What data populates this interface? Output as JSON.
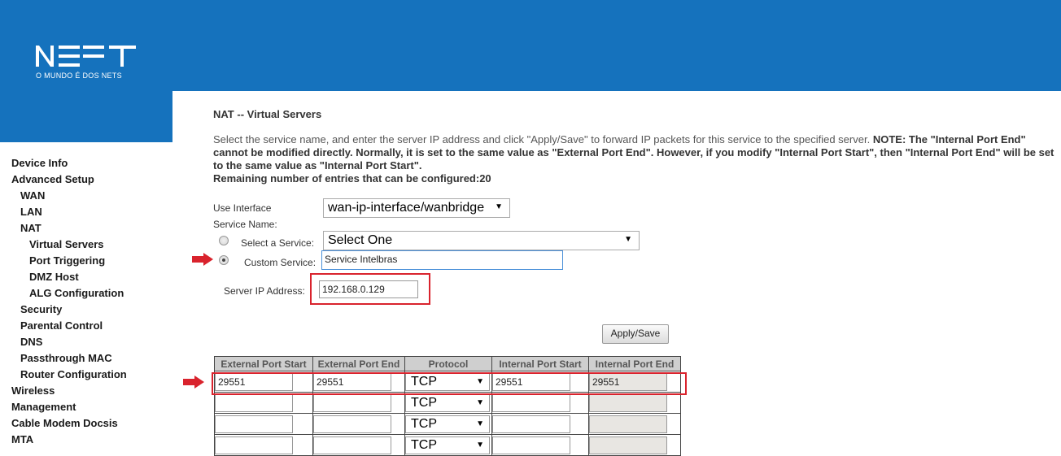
{
  "brand": {
    "logo_text": "NET",
    "tagline": "O MUNDO É DOS NETS",
    "color": "#1572bd"
  },
  "sidebar": {
    "items": [
      {
        "label": "Device Info",
        "level": 0
      },
      {
        "label": "Advanced Setup",
        "level": 0
      },
      {
        "label": "WAN",
        "level": 1
      },
      {
        "label": "LAN",
        "level": 1
      },
      {
        "label": "NAT",
        "level": 1
      },
      {
        "label": "Virtual Servers",
        "level": 2
      },
      {
        "label": "Port Triggering",
        "level": 2
      },
      {
        "label": "DMZ Host",
        "level": 2
      },
      {
        "label": "ALG Configuration",
        "level": 2
      },
      {
        "label": "Security",
        "level": 1
      },
      {
        "label": "Parental Control",
        "level": 1
      },
      {
        "label": "DNS",
        "level": 1
      },
      {
        "label": "Passthrough MAC",
        "level": 1
      },
      {
        "label": "Router Configuration",
        "level": 1
      },
      {
        "label": "Wireless",
        "level": 0
      },
      {
        "label": "Management",
        "level": 0
      },
      {
        "label": "Cable Modem Docsis",
        "level": 0
      },
      {
        "label": "MTA",
        "level": 0
      }
    ]
  },
  "page": {
    "title": "NAT -- Virtual Servers",
    "description_plain": "Select the service name, and enter the server IP address and click \"Apply/Save\" to forward IP packets for this service to the specified server.",
    "description_note": "NOTE: The \"Internal Port End\" cannot be modified directly. Normally, it is set to the same value as \"External Port End\". However, if you modify \"Internal Port Start\", then \"Internal Port End\" will be set to the same value as \"Internal Port Start\".",
    "remaining_label": "Remaining number of entries that can be configured:",
    "remaining_value": "20"
  },
  "form": {
    "use_interface_label": "Use Interface",
    "use_interface_value": "wan-ip-interface/wanbridge",
    "service_name_label": "Service Name:",
    "select_service_label": "Select a Service:",
    "select_service_value": "Select One",
    "custom_service_label": "Custom Service:",
    "custom_service_value": "Service Intelbras",
    "server_ip_label": "Server IP Address:",
    "server_ip_value": "192.168.0.129",
    "apply_button": "Apply/Save",
    "highlight_color": "#d9232d"
  },
  "table": {
    "headers": [
      "External Port Start",
      "External Port End",
      "Protocol",
      "Internal Port Start",
      "Internal Port End"
    ],
    "rows": [
      {
        "ext_start": "29551",
        "ext_end": "29551",
        "protocol": "TCP",
        "int_start": "29551",
        "int_end": "29551"
      },
      {
        "ext_start": "",
        "ext_end": "",
        "protocol": "TCP",
        "int_start": "",
        "int_end": ""
      },
      {
        "ext_start": "",
        "ext_end": "",
        "protocol": "TCP",
        "int_start": "",
        "int_end": ""
      },
      {
        "ext_start": "",
        "ext_end": "",
        "protocol": "TCP",
        "int_start": "",
        "int_end": ""
      }
    ]
  }
}
